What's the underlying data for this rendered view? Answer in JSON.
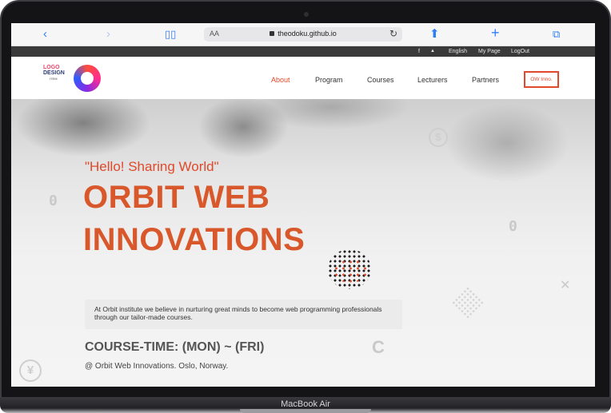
{
  "device_label": "MacBook Air",
  "browser": {
    "text_size_label": "AA",
    "url": "theodoku.github.io",
    "icons": [
      "chevron-left-icon",
      "chevron-right-icon",
      "book-icon",
      "lock-icon",
      "reload-icon",
      "share-icon",
      "plus-icon",
      "tabs-icon"
    ]
  },
  "utility_bar": {
    "facebook": "f",
    "twitter": "🐦",
    "language": "English",
    "my_page": "My Page",
    "logout": "LogOut"
  },
  "logo": {
    "line1": "LOGO",
    "line2": "DESIGN",
    "line3": "ITEM"
  },
  "nav": {
    "items": [
      {
        "label": "About",
        "active": true
      },
      {
        "label": "Program",
        "active": false
      },
      {
        "label": "Courses",
        "active": false
      },
      {
        "label": "Lecturers",
        "active": false
      },
      {
        "label": "Partners",
        "active": false
      }
    ],
    "box_label": "OW Inno."
  },
  "hero": {
    "subtitle": "\"Hello! Sharing World\"",
    "title_line1": "ORBIT WEB",
    "title_line2": "INNOVATIONS",
    "intro": "At Orbit institute we believe in nurturing great minds to become web programming professionals through our tailor-made courses.",
    "course_time": "COURSE-TIME: (MON) ~ (FRI)",
    "location": "@ Orbit Web Innovations. Oslo, Norway.",
    "decor": {
      "zero_left": "0",
      "zero_right": "0",
      "c_symbol": "C",
      "dollar_symbol": "$",
      "yen_symbol": "¥",
      "cross_symbol": "✕"
    }
  },
  "colors": {
    "accent": "#e0492a",
    "title": "#d9582b",
    "utility_bg": "#3a3a3a",
    "browser_blue": "#2f7df6"
  }
}
